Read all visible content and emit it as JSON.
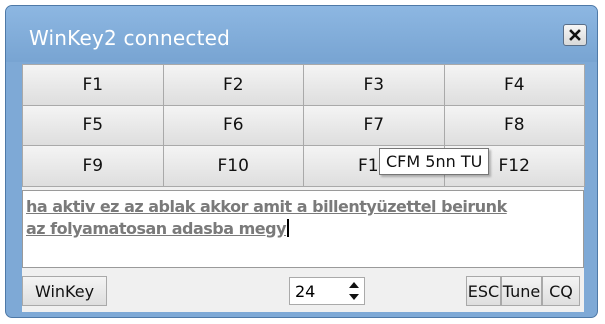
{
  "window": {
    "title": "WinKey2 connected",
    "close_icon": "close-icon"
  },
  "function_keys": [
    "F1",
    "F2",
    "F3",
    "F4",
    "F5",
    "F6",
    "F7",
    "F8",
    "F9",
    "F10",
    "F11",
    "F12"
  ],
  "tooltip": "CFM 5nn TU",
  "textbox": {
    "line1": "ha aktiv ez az ablak akkor amit a billentyüzettel beirunk",
    "line2": "az folyamatosan adasba megy"
  },
  "bottom": {
    "winkey_label": "WinKey",
    "speed_value": "24",
    "esc_label": "ESC",
    "tune_label": "Tune",
    "cq_label": "CQ"
  }
}
